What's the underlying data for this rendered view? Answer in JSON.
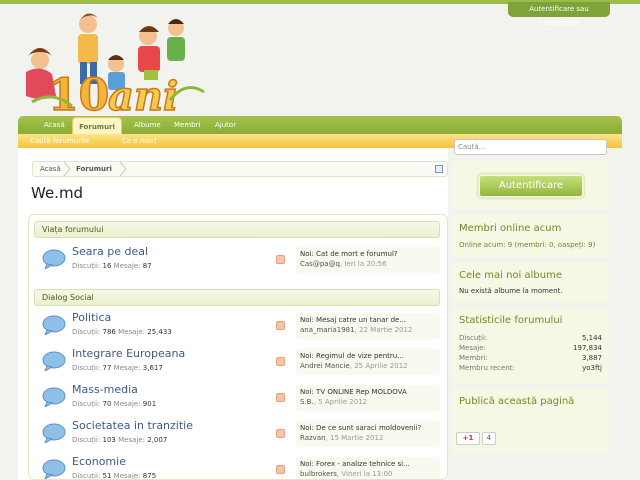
{
  "header": {
    "login_tab": "Autentificare sau înregistrare"
  },
  "nav": {
    "items": [
      "Acasă",
      "Forumuri",
      "Albume",
      "Membri",
      "Ajutor"
    ],
    "active": 1
  },
  "subnav": {
    "items": [
      "Caută forumurile",
      "Ce e nou?"
    ]
  },
  "search": {
    "placeholder": "Caută..."
  },
  "breadcrumb": [
    "Acasă",
    "Forumuri"
  ],
  "page_title": "We.md",
  "categories": [
    {
      "name": "Viața forumului",
      "nodes": [
        {
          "title": "Seara pe deal",
          "discussions_label": "Discuții:",
          "discussions": "16",
          "messages_label": "Mesaje:",
          "messages": "87",
          "last_title": "Noi: Cat de mort e forumul?",
          "last_author": "Cas@pa@q",
          "last_date": "Ieri la 20:56"
        }
      ]
    },
    {
      "name": "Dialog Social",
      "nodes": [
        {
          "title": "Politica",
          "discussions_label": "Discuții:",
          "discussions": "786",
          "messages_label": "Mesaje:",
          "messages": "25,433",
          "last_title": "Noi: Mesaj catre un tanar de...",
          "last_author": "ana_maria1981",
          "last_date": "22 Martie 2012"
        },
        {
          "title": "Integrare Europeana",
          "discussions_label": "Discuții:",
          "discussions": "77",
          "messages_label": "Mesaje:",
          "messages": "3,617",
          "last_title": "Noi: Regimul de vize pentru...",
          "last_author": "Andrei Mancie",
          "last_date": "25 Aprilie 2012"
        },
        {
          "title": "Mass-media",
          "discussions_label": "Discuții:",
          "discussions": "70",
          "messages_label": "Mesaje:",
          "messages": "901",
          "last_title": "Noi: TV ONLINE Rep MOLDOVA",
          "last_author": "S.B.",
          "last_date": "5 Aprilie 2012"
        },
        {
          "title": "Societatea in tranzitie",
          "discussions_label": "Discuții:",
          "discussions": "103",
          "messages_label": "Mesaje:",
          "messages": "2,007",
          "last_title": "Noi: De ce sunt saraci moldovenii?",
          "last_author": "Razvan",
          "last_date": "15 Martie 2012"
        },
        {
          "title": "Economie",
          "discussions_label": "Discuții:",
          "discussions": "51",
          "messages_label": "Mesaje:",
          "messages": "875",
          "last_title": "Noi: Forex - analize tehnice si...",
          "last_author": "bulbrokers",
          "last_date": "Vineri la 13:00"
        }
      ]
    }
  ],
  "sidebar": {
    "auth_button": "Autentificare",
    "online": {
      "title": "Membri online acum",
      "text": "Online acum: 9 (membri: 0, oaspeți: 9)"
    },
    "albums": {
      "title": "Cele mai noi albume",
      "text": "Nu există albume la moment."
    },
    "stats": {
      "title": "Statisticile forumului",
      "rows": [
        {
          "label": "Discuții:",
          "value": "5,144"
        },
        {
          "label": "Mesaje:",
          "value": "197,834"
        },
        {
          "label": "Membri:",
          "value": "3,887"
        },
        {
          "label": "Membru recent:",
          "value": "yo3ftj"
        }
      ]
    },
    "share": {
      "title": "Publică această pagină",
      "gplus": "+1",
      "count": "4"
    }
  },
  "colors": {
    "accent_green": "#9dbb4a",
    "accent_yellow": "#f4c23c",
    "link_blue": "#3b5a8a"
  }
}
